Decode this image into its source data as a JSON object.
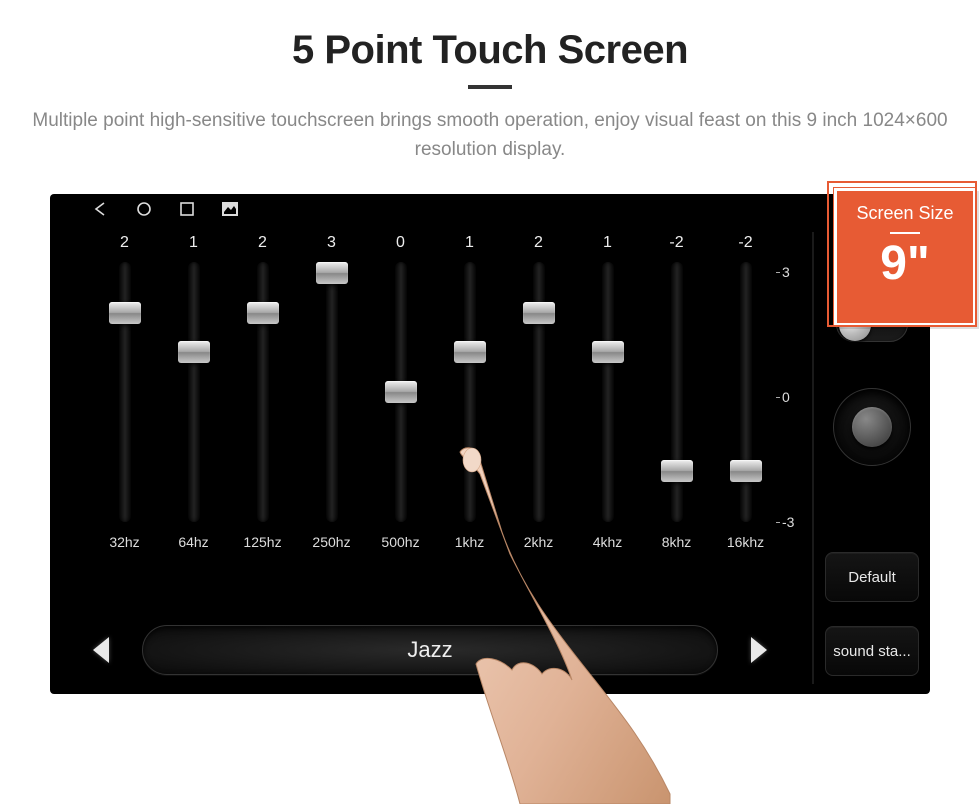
{
  "hero": {
    "title": "5 Point Touch Screen",
    "desc": "Multiple point high-sensitive touchscreen brings smooth operation, enjoy visual feast on this 9 inch 1024×600 resolution display."
  },
  "badge": {
    "label": "Screen Size",
    "value": "9\""
  },
  "eq": {
    "scale": {
      "max": "3",
      "mid": "0",
      "min": "-3"
    },
    "bands": [
      {
        "freq": "32hz",
        "value": "2",
        "gain": 2
      },
      {
        "freq": "64hz",
        "value": "1",
        "gain": 1
      },
      {
        "freq": "125hz",
        "value": "2",
        "gain": 2
      },
      {
        "freq": "250hz",
        "value": "3",
        "gain": 3
      },
      {
        "freq": "500hz",
        "value": "0",
        "gain": 0
      },
      {
        "freq": "1khz",
        "value": "1",
        "gain": 1
      },
      {
        "freq": "2khz",
        "value": "2",
        "gain": 2
      },
      {
        "freq": "4khz",
        "value": "1",
        "gain": 1
      },
      {
        "freq": "8khz",
        "value": "-2",
        "gain": -2
      },
      {
        "freq": "16khz",
        "value": "-2",
        "gain": -2
      }
    ],
    "preset": "Jazz"
  },
  "side": {
    "toggle_on": false,
    "default_label": "Default",
    "sound_label": "sound sta..."
  },
  "icons": {
    "back": "back-icon",
    "home": "home-icon",
    "recent": "recent-icon",
    "gallery": "gallery-icon",
    "location": "location-icon"
  }
}
